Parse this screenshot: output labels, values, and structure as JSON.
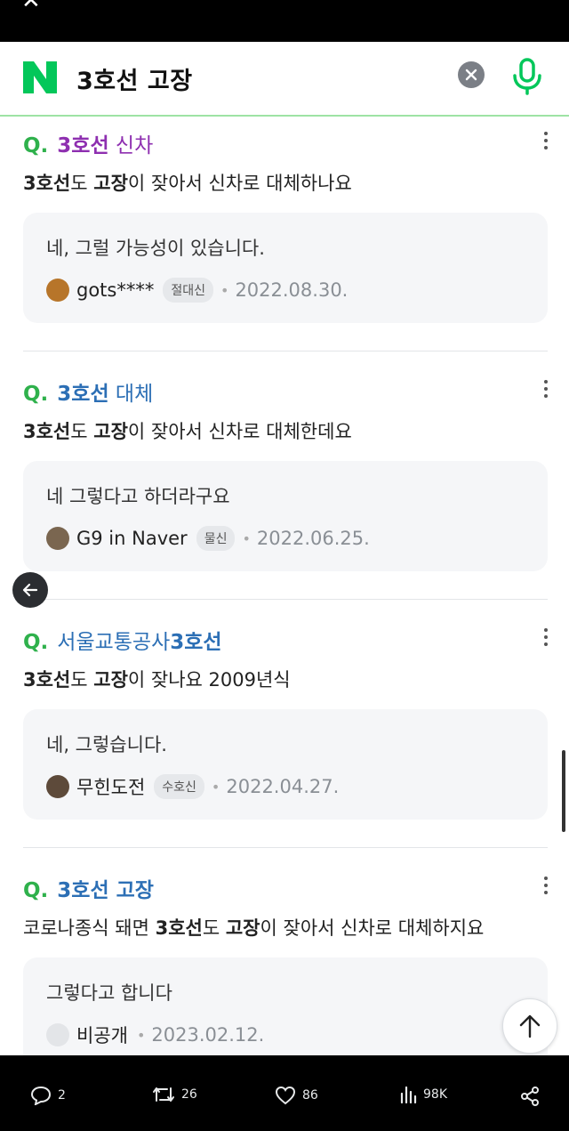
{
  "search": {
    "query": "3호선 고장"
  },
  "results": [
    {
      "title_pre": "",
      "title_hl": "3호선",
      "title_post": " 신차",
      "title_color": "#8e2fb0",
      "desc": [
        [
          "3호선",
          true
        ],
        [
          "도 ",
          false
        ],
        [
          "고장",
          true
        ],
        [
          "이 잦아서 신차로 대체하나요",
          false
        ]
      ],
      "answer": "네, 그럴 가능성이 있습니다.",
      "user": "gots****",
      "badge": "절대신",
      "date": "2022.08.30."
    },
    {
      "title_pre": "",
      "title_hl": "3호선",
      "title_post": " 대체",
      "title_color": "#2c6fb5",
      "desc": [
        [
          "3호선",
          true
        ],
        [
          "도 ",
          false
        ],
        [
          "고장",
          true
        ],
        [
          "이 잦아서 신차로 대체한데요",
          false
        ]
      ],
      "answer": "네 그렇다고 하더라구요",
      "user": "G9 in Naver",
      "badge": "물신",
      "date": "2022.06.25."
    },
    {
      "title_pre": "서울교통공사",
      "title_hl": "3호선",
      "title_post": "",
      "title_color": "#2c6fb5",
      "desc": [
        [
          "3호선",
          true
        ],
        [
          "도 ",
          false
        ],
        [
          "고장",
          true
        ],
        [
          "이 잦나요 2009년식",
          false
        ]
      ],
      "answer": "네, 그렇습니다.",
      "user": "무힌도전",
      "badge": "수호신",
      "date": "2022.04.27."
    },
    {
      "title_pre": "",
      "title_hl": "3호선 고장",
      "title_post": "",
      "title_color": "#2c6fb5",
      "desc": [
        [
          "코로나종식 돼면 ",
          false
        ],
        [
          "3호선",
          true
        ],
        [
          "도 ",
          false
        ],
        [
          "고장",
          true
        ],
        [
          "이 잦아서 신차로 대체하지요",
          false
        ]
      ],
      "answer": "그렇다고 합니다",
      "user": "비공개",
      "badge": "",
      "date": "2023.02.12."
    }
  ],
  "footer": {
    "replies": "2",
    "reposts": "26",
    "likes": "86",
    "views": "98K"
  },
  "colors": {
    "naver_green": "#03c75a",
    "qmark_green": "#2fb14c",
    "link_blue": "#2c6fb5",
    "title_purple": "#8e2fb0"
  }
}
